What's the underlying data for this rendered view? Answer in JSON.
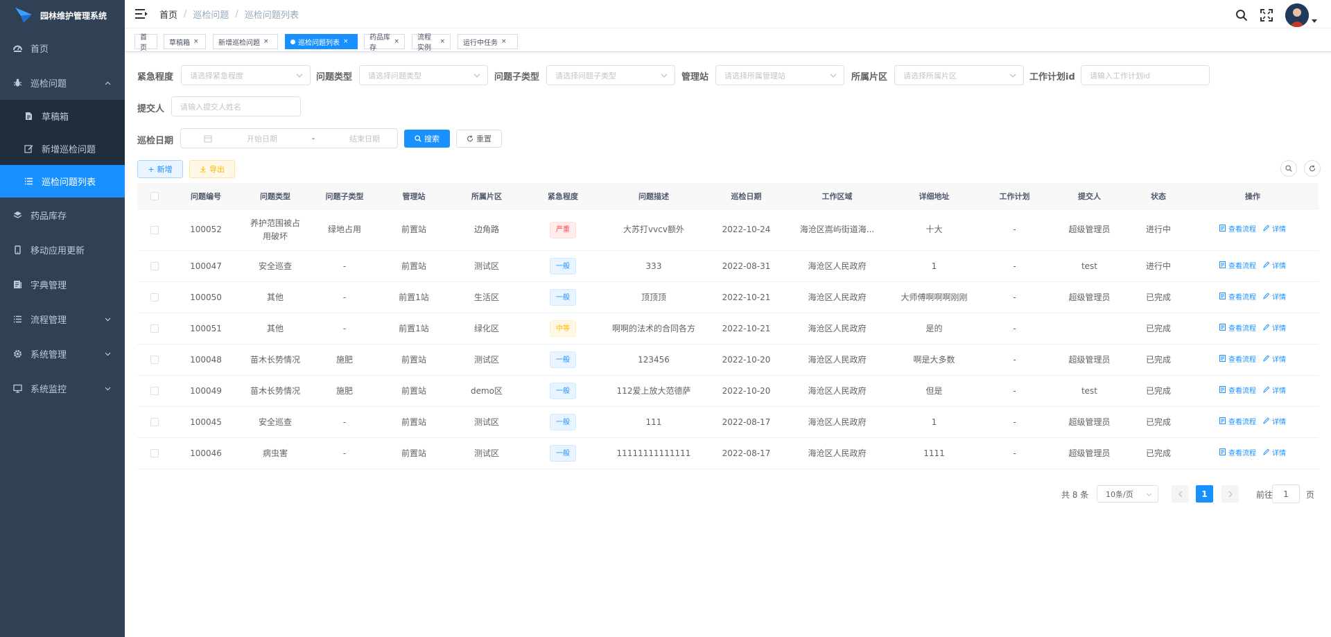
{
  "app": {
    "title": "园林维护管理系统"
  },
  "sidebar": {
    "items": [
      {
        "label": "首页",
        "icon": "dashboard-icon"
      },
      {
        "label": "巡检问题",
        "icon": "bug-icon",
        "expanded": true,
        "children": [
          {
            "label": "草稿箱",
            "icon": "document-icon"
          },
          {
            "label": "新增巡检问题",
            "icon": "edit-icon"
          },
          {
            "label": "巡检问题列表",
            "icon": "list-icon",
            "active": true
          }
        ]
      },
      {
        "label": "药品库存",
        "icon": "layers-icon"
      },
      {
        "label": "移动应用更新",
        "icon": "phone-icon"
      },
      {
        "label": "字典管理",
        "icon": "dict-icon"
      },
      {
        "label": "流程管理",
        "icon": "list-icon"
      },
      {
        "label": "系统管理",
        "icon": "gear-icon"
      },
      {
        "label": "系统监控",
        "icon": "monitor-icon"
      }
    ]
  },
  "breadcrumb": [
    "首页",
    "巡检问题",
    "巡检问题列表"
  ],
  "tags": [
    {
      "label": "首页",
      "closable": false
    },
    {
      "label": "草稿箱",
      "closable": true
    },
    {
      "label": "新增巡检问题",
      "closable": true
    },
    {
      "label": "巡检问题列表",
      "closable": true,
      "active": true
    },
    {
      "label": "药品库存",
      "closable": true
    },
    {
      "label": "流程实例",
      "closable": true
    },
    {
      "label": "运行中任务",
      "closable": true
    }
  ],
  "filters": {
    "urgency": {
      "label": "紧急程度",
      "placeholder": "请选择紧急程度"
    },
    "type": {
      "label": "问题类型",
      "placeholder": "请选择问题类型"
    },
    "subtype": {
      "label": "问题子类型",
      "placeholder": "请选择问题子类型"
    },
    "station": {
      "label": "管理站",
      "placeholder": "请选择所属管理站"
    },
    "area": {
      "label": "所属片区",
      "placeholder": "请选择所属片区"
    },
    "plan": {
      "label": "工作计划id",
      "placeholder": "请输入工作计划id"
    },
    "submitter": {
      "label": "提交人",
      "placeholder": "请输入提交人姓名"
    },
    "date": {
      "label": "巡检日期",
      "start": "开始日期",
      "sep": "-",
      "end": "结束日期"
    },
    "search_label": "搜索",
    "reset_label": "重置"
  },
  "toolbar": {
    "add_label": "新增",
    "export_label": "导出"
  },
  "table": {
    "columns": [
      "问题编号",
      "问题类型",
      "问题子类型",
      "管理站",
      "所属片区",
      "紧急程度",
      "问题描述",
      "巡检日期",
      "工作区域",
      "详细地址",
      "工作计划",
      "提交人",
      "状态",
      "操作"
    ],
    "view_flow_label": "查看流程",
    "detail_label": "详情",
    "rows": [
      {
        "id": "100052",
        "type": "养护范围被占用破坏",
        "subtype": "绿地占用",
        "station": "前置站",
        "area": "边角路",
        "urgency": "严重",
        "urgency_level": "danger",
        "desc": "大苏打vvcv额外",
        "date": "2022-10-24",
        "region": "海沧区嵩屿街道海...",
        "address": "十大",
        "plan": "-",
        "submitter": "超级管理员",
        "status": "进行中"
      },
      {
        "id": "100047",
        "type": "安全巡查",
        "subtype": "-",
        "station": "前置站",
        "area": "测试区",
        "urgency": "一般",
        "urgency_level": "primary",
        "desc": "333",
        "date": "2022-08-31",
        "region": "海沧区人民政府",
        "address": "1",
        "plan": "-",
        "submitter": "test",
        "status": "进行中"
      },
      {
        "id": "100050",
        "type": "其他",
        "subtype": "-",
        "station": "前置1站",
        "area": "生活区",
        "urgency": "一般",
        "urgency_level": "primary",
        "desc": "顶顶顶",
        "date": "2022-10-21",
        "region": "海沧区人民政府",
        "address": "大师傅啊啊啊刚刚",
        "plan": "-",
        "submitter": "超级管理员",
        "status": "已完成"
      },
      {
        "id": "100051",
        "type": "其他",
        "subtype": "-",
        "station": "前置1站",
        "area": "绿化区",
        "urgency": "中等",
        "urgency_level": "warning",
        "desc": "啊啊的法术的合同各方",
        "date": "2022-10-21",
        "region": "海沧区人民政府",
        "address": "是的",
        "plan": "-",
        "submitter": "",
        "status": "已完成"
      },
      {
        "id": "100048",
        "type": "苗木长势情况",
        "subtype": "施肥",
        "station": "前置站",
        "area": "测试区",
        "urgency": "一般",
        "urgency_level": "primary",
        "desc": "123456",
        "date": "2022-10-20",
        "region": "海沧区人民政府",
        "address": "啊是大多数",
        "plan": "-",
        "submitter": "超级管理员",
        "status": "已完成"
      },
      {
        "id": "100049",
        "type": "苗木长势情况",
        "subtype": "施肥",
        "station": "前置站",
        "area": "demo区",
        "urgency": "一般",
        "urgency_level": "primary",
        "desc": "112爱上放大范德萨",
        "date": "2022-10-20",
        "region": "海沧区人民政府",
        "address": "但是",
        "plan": "-",
        "submitter": "test",
        "status": "已完成"
      },
      {
        "id": "100045",
        "type": "安全巡查",
        "subtype": "-",
        "station": "前置站",
        "area": "测试区",
        "urgency": "一般",
        "urgency_level": "primary",
        "desc": "111",
        "date": "2022-08-17",
        "region": "海沧区人民政府",
        "address": "1",
        "plan": "-",
        "submitter": "超级管理员",
        "status": "已完成"
      },
      {
        "id": "100046",
        "type": "病虫害",
        "subtype": "-",
        "station": "前置站",
        "area": "测试区",
        "urgency": "一般",
        "urgency_level": "primary",
        "desc": "11111111111111",
        "date": "2022-08-17",
        "region": "海沧区人民政府",
        "address": "1111",
        "plan": "-",
        "submitter": "超级管理员",
        "status": "已完成"
      }
    ]
  },
  "pagination": {
    "total": "共 8 条",
    "page_size": "10条/页",
    "current_page": "1",
    "goto_prefix": "前往",
    "goto_value": "1",
    "goto_suffix": "页"
  },
  "colors": {
    "sidebar": "#304156",
    "submenu": "#1f2d3d",
    "primary": "#1890ff",
    "danger": "#ff4949",
    "warning": "#ffba00"
  }
}
